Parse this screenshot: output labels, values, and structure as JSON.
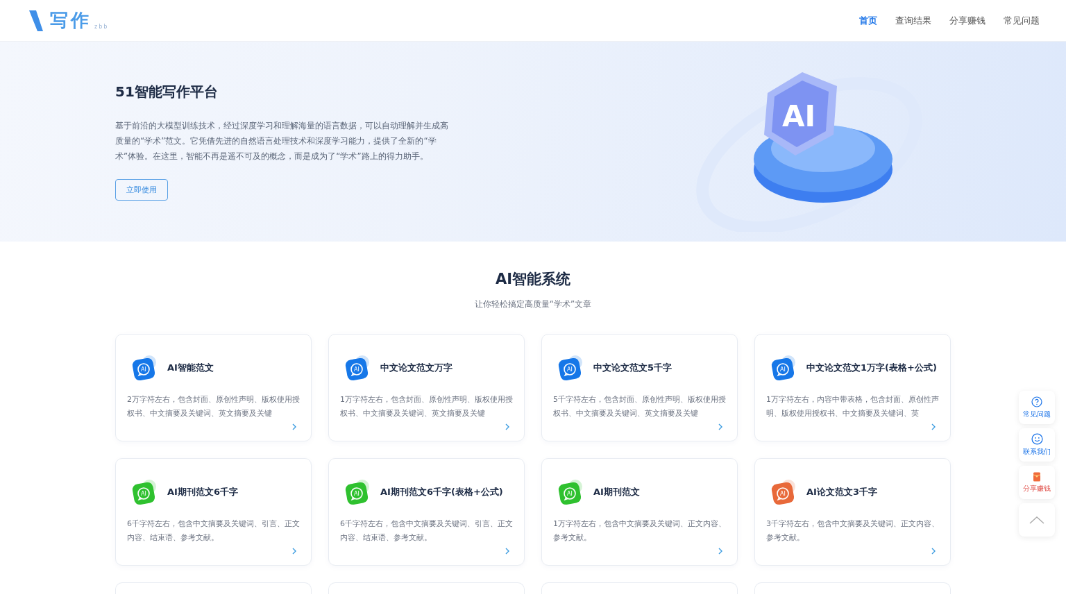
{
  "logo": {
    "text": "写作",
    "sub": "zbb"
  },
  "nav": [
    {
      "label": "首页",
      "selected": true
    },
    {
      "label": "查询结果",
      "selected": false
    },
    {
      "label": "分享赚钱",
      "selected": false
    },
    {
      "label": "常见问题",
      "selected": false
    }
  ],
  "hero": {
    "title": "51智能写作平台",
    "description": "基于前沿的大模型训练技术，经过深度学习和理解海量的语言数据，可以自动理解并生成高质量的“学术”范文。它凭借先进的自然语言处理技术和深度学习能力，提供了全新的“学术”体验。在这里，智能不再是遥不可及的概念，而是成为了“学术”路上的得力助手。",
    "button": "立即使用",
    "illustration_label": "AI"
  },
  "section": {
    "title": "AI智能系统",
    "subtitle": "让你轻松搞定高质量“学术”文章"
  },
  "cards": [
    {
      "title": "AI智能范文",
      "description": "2万字符左右，包含封面、原创性声明、版权使用授权书、中文摘要及关键词、英文摘要及关键",
      "color": "#1677e8",
      "icon_label": "AI"
    },
    {
      "title": "中文论文范文万字",
      "description": "1万字符左右，包含封面、原创性声明、版权使用授权书、中文摘要及关键词、英文摘要及关键",
      "color": "#1677e8",
      "icon_label": "AI"
    },
    {
      "title": "中文论文范文5千字",
      "description": "5千字符左右，包含封面、原创性声明、版权使用授权书、中文摘要及关键词、英文摘要及关键",
      "color": "#1677e8",
      "icon_label": "AI"
    },
    {
      "title": "中文论文范文1万字(表格+公式)",
      "description": "1万字符左右，内容中带表格，包含封面、原创性声明、版权使用授权书、中文摘要及关键词、英",
      "color": "#1677e8",
      "icon_label": "AI"
    },
    {
      "title": "AI期刊范文6千字",
      "description": "6千字符左右，包含中文摘要及关键词、引言、正文内容、结束语、参考文献。",
      "color": "#2fc12f",
      "icon_label": "AI"
    },
    {
      "title": "AI期刊范文6千字(表格+公式)",
      "description": "6千字符左右，包含中文摘要及关键词、引言、正文内容、结束语、参考文献。",
      "color": "#2fc12f",
      "icon_label": "AI"
    },
    {
      "title": "AI期刊范文",
      "description": "1万字符左右，包含中文摘要及关键词、正文内容、参考文献。",
      "color": "#2fc12f",
      "icon_label": "AI"
    },
    {
      "title": "AI论文范文3千字",
      "description": "3千字符左右，包含中文摘要及关键词、正文内容、参考文献。",
      "color": "#e8693a",
      "icon_label": "AI"
    }
  ],
  "float_bar": [
    {
      "kind": "question",
      "label": "常见问题"
    },
    {
      "kind": "contact",
      "label": "联系我们"
    },
    {
      "kind": "share",
      "label": "分享赚钱"
    },
    {
      "kind": "top"
    }
  ]
}
